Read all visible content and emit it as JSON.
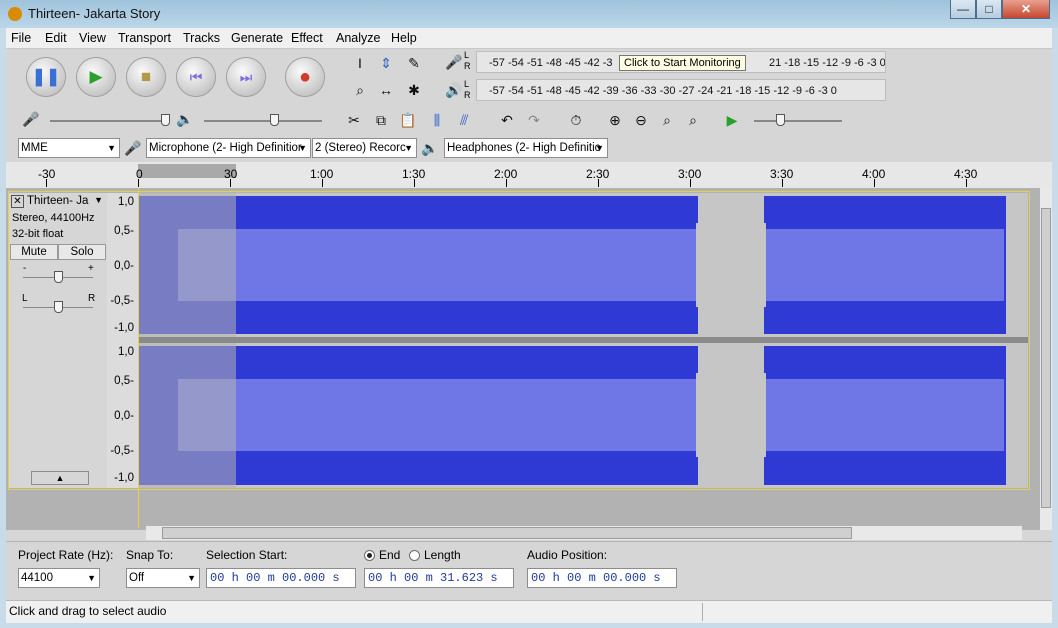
{
  "window": {
    "title": "Thirteen- Jakarta Story",
    "minimize": "—",
    "maximize": "□",
    "close": "✕"
  },
  "menu": [
    "File",
    "Edit",
    "View",
    "Transport",
    "Tracks",
    "Generate",
    "Effect",
    "Analyze",
    "Help"
  ],
  "meters": {
    "record_lr": "L R",
    "play_lr": "L R",
    "record_scale": "-57 -54 -51 -48 -45 -42 -3",
    "record_scale_tail": "21 -18 -15 -12  -9  -6  -3  0",
    "play_scale": "-57 -54 -51 -48 -45 -42 -39 -36 -33 -30 -27 -24 -21 -18 -15 -12  -9  -6  -3  0",
    "tooltip": "Click to Start Monitoring"
  },
  "devices": {
    "host": "MME",
    "input": "Microphone (2- High Definitior",
    "channels": "2 (Stereo) Recorc",
    "output": "Headphones (2- High Definitic"
  },
  "ruler": {
    "labels": [
      "-30",
      "0",
      "30",
      "1:00",
      "1:30",
      "2:00",
      "2:30",
      "3:00",
      "3:30",
      "4:00",
      "4:30"
    ]
  },
  "track": {
    "name": "Thirteen- Ja",
    "info1": "Stereo, 44100Hz",
    "info2": "32-bit float",
    "mute": "Mute",
    "solo": "Solo",
    "gain_minus": "-",
    "gain_plus": "+",
    "pan_left": "L",
    "pan_right": "R",
    "scale_top": [
      "1,0",
      "0,5-",
      "0,0-",
      "-0,5-",
      "-1,0"
    ],
    "scale_bottom": [
      "1,0",
      "0,5-",
      "0,0-",
      "-0,5-",
      "-1,0"
    ]
  },
  "selection_bar": {
    "project_rate_label": "Project Rate (Hz):",
    "project_rate": "44100",
    "snap_label": "Snap To:",
    "snap_value": "Off",
    "selection_start_label": "Selection Start:",
    "end_label": "End",
    "length_label": "Length",
    "selection_start": "00 h 00 m 00.000 s",
    "selection_end": "00 h 00 m 31.623 s",
    "audio_position_label": "Audio Position:",
    "audio_position": "00 h 00 m 00.000 s"
  },
  "status": "Click and drag to select audio"
}
